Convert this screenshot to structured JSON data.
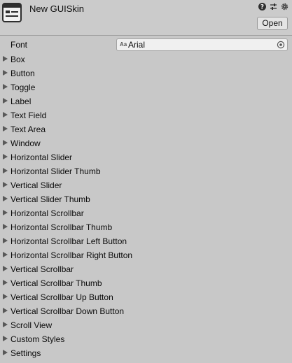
{
  "header": {
    "title": "New GUISkin",
    "open_label": "Open",
    "icons": [
      "help-icon",
      "preset-icon",
      "settings-icon"
    ]
  },
  "font_field": {
    "label": "Font",
    "value": "Arial",
    "prefix": "Aa"
  },
  "foldouts": [
    "Box",
    "Button",
    "Toggle",
    "Label",
    "Text Field",
    "Text Area",
    "Window",
    "Horizontal Slider",
    "Horizontal Slider Thumb",
    "Vertical Slider",
    "Vertical Slider Thumb",
    "Horizontal Scrollbar",
    "Horizontal Scrollbar Thumb",
    "Horizontal Scrollbar Left Button",
    "Horizontal Scrollbar Right Button",
    "Vertical Scrollbar",
    "Vertical Scrollbar Thumb",
    "Vertical Scrollbar Up Button",
    "Vertical Scrollbar Down Button",
    "Scroll View",
    "Custom Styles",
    "Settings"
  ]
}
